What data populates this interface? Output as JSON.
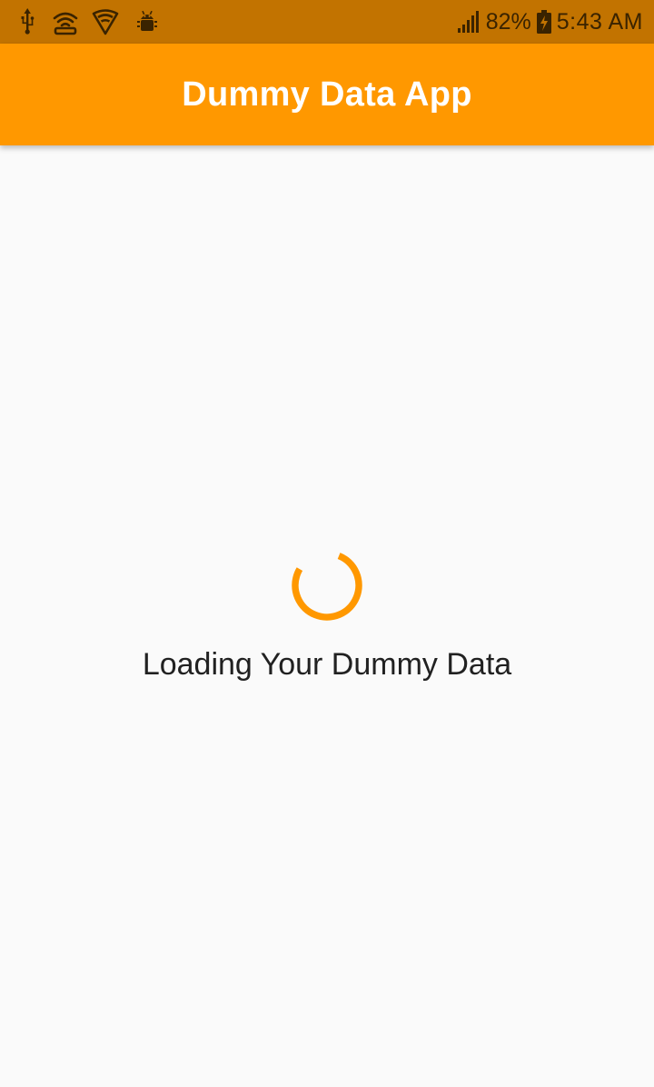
{
  "status_bar": {
    "icons": [
      "usb-icon",
      "wifi-hotspot-icon",
      "vpn-shield-icon",
      "android-debug-icon"
    ],
    "battery_percent": "82%",
    "time": "5:43 AM"
  },
  "app_bar": {
    "title": "Dummy Data App"
  },
  "main": {
    "loading_text": "Loading Your Dummy Data"
  },
  "colors": {
    "status_bar": "#C27300",
    "app_bar": "#FF9800",
    "spinner": "#FF9800",
    "background": "#FAFAFA"
  }
}
